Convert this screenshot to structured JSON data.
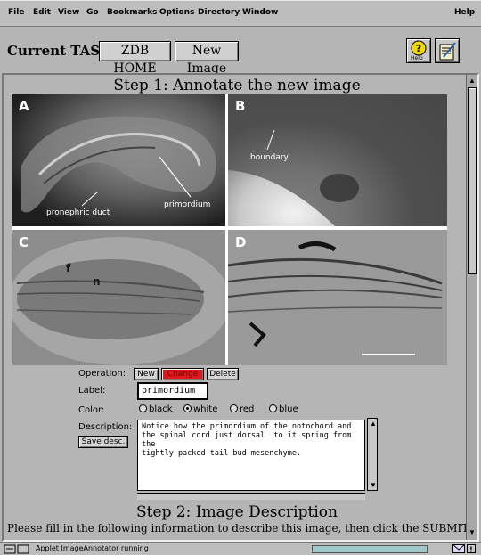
{
  "menu": {
    "items": [
      "File",
      "Edit",
      "View",
      "Go",
      "Bookmarks",
      "Options",
      "Directory",
      "Window"
    ],
    "help": "Help"
  },
  "task": {
    "label": "Current TASK:",
    "zdb_home": "ZDB HOME",
    "new_image": "New Image",
    "help_icon_label": "Help"
  },
  "step1": {
    "title": "Step 1: Annotate the new image",
    "panels": [
      {
        "letter": "A",
        "annotations": [
          "pronephric duct",
          "primordium"
        ]
      },
      {
        "letter": "B",
        "annotations": [
          "boundary"
        ]
      },
      {
        "letter": "C",
        "annotations": [
          "f",
          "n"
        ]
      },
      {
        "letter": "D",
        "annotations": []
      }
    ]
  },
  "form": {
    "operation_label": "Operation:",
    "ops": [
      "New",
      "Change",
      "Delete"
    ],
    "active_op": "Change",
    "label_label": "Label:",
    "label_value": "primordium",
    "color_label": "Color:",
    "colors": [
      "black",
      "white",
      "red",
      "blue"
    ],
    "selected_color": "white",
    "description_label": "Description:",
    "save_desc": "Save desc.",
    "description_text": "Notice how the primordium of the notochord and\nthe spinal cord just dorsal  to it spring from the\ntightly packed tail bud mesenchyme."
  },
  "step2": {
    "title": "Step 2: Image Description",
    "subtitle": "Please fill in the following information to describe this image, then click the SUBMIT"
  },
  "status": {
    "text": "Applet ImageAnnotator running"
  },
  "colors": {
    "change_button": "#e0181c",
    "background": "#b5b5b5"
  }
}
